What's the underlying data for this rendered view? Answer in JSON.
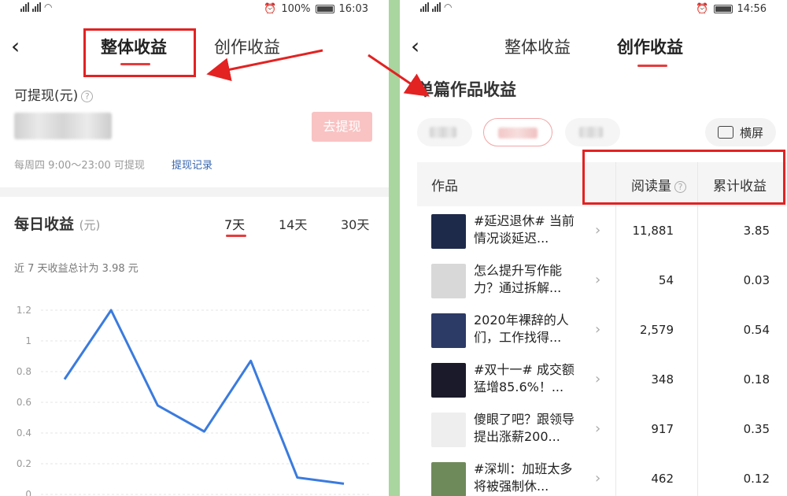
{
  "left": {
    "status": {
      "battery": "100%",
      "time": "16:03"
    },
    "tabs": [
      "整体收益",
      "创作收益"
    ],
    "withdrawable_label": "可提现(元)",
    "withdraw_button": "去提现",
    "schedule": "每周四 9:00～23:00 可提现",
    "withdraw_record": "提现记录",
    "daily_title": "每日收益",
    "daily_unit": "(元)",
    "ranges": [
      "7天",
      "14天",
      "30天"
    ],
    "summary": "近 7 天收益总计为 3.98 元"
  },
  "right": {
    "status": {
      "time": "14:56"
    },
    "tabs": [
      "整体收益",
      "创作收益"
    ],
    "section_title": "单篇作品收益",
    "landscape_label": "横屏",
    "columns": [
      "作品",
      "阅读量",
      "累计收益"
    ],
    "rows": [
      {
        "title": "#延迟退休# 当前情况谈延迟...",
        "reads": "11,881",
        "earnings": "3.85",
        "thumb": "#1e2a4a"
      },
      {
        "title": "怎么提升写作能力？通过拆解...",
        "reads": "54",
        "earnings": "0.03",
        "thumb": "#d8d8d8"
      },
      {
        "title": "2020年裸辞的人们，工作找得...",
        "reads": "2,579",
        "earnings": "0.54",
        "thumb": "#2c3a66"
      },
      {
        "title": "#双十一# 成交额猛增85.6%！...",
        "reads": "348",
        "earnings": "0.18",
        "thumb": "#1a1a2a"
      },
      {
        "title": "傻眼了吧？跟领导提出涨薪200...",
        "reads": "917",
        "earnings": "0.35",
        "thumb": "#eeeeee"
      },
      {
        "title": "#深圳：加班太多将被强制休...",
        "reads": "462",
        "earnings": "0.12",
        "thumb": "#6f8a5a"
      }
    ]
  },
  "chart_data": {
    "type": "line",
    "x": [
      1,
      2,
      3,
      4,
      5,
      6,
      7
    ],
    "values": [
      0.75,
      1.2,
      0.58,
      0.41,
      0.87,
      0.11,
      0.07
    ],
    "ylim": [
      0,
      1.2
    ],
    "yticks": [
      "0",
      "0.2",
      "0.4",
      "0.6",
      "0.8",
      "1",
      "1.2"
    ],
    "color": "#3a7bde",
    "grid": true
  }
}
